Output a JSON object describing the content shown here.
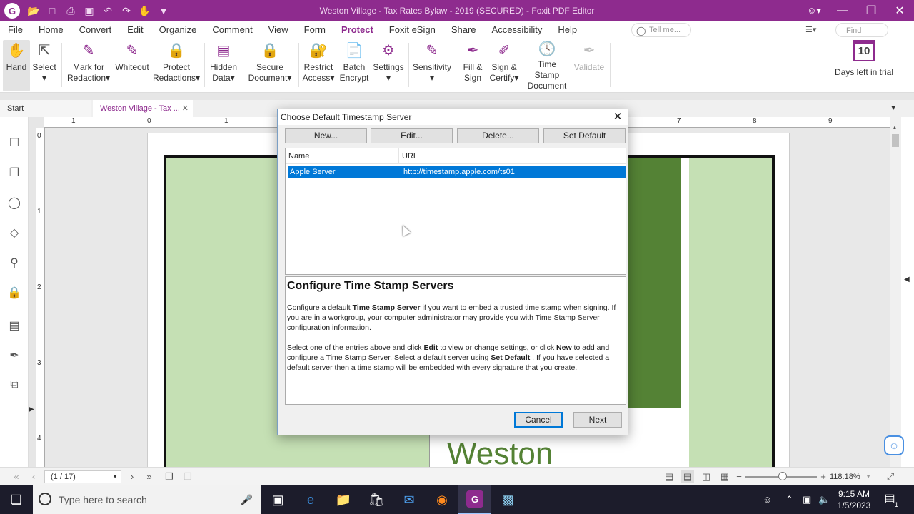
{
  "window": {
    "title": "Weston Village - Tax Rates Bylaw - 2019 (SECURED) - Foxit PDF Editor",
    "app_logo": "G"
  },
  "menu": {
    "tabs": [
      "File",
      "Home",
      "Convert",
      "Edit",
      "Organize",
      "Comment",
      "View",
      "Form",
      "Protect",
      "Foxit eSign",
      "Share",
      "Accessibility",
      "Help"
    ],
    "active_tab": "Protect",
    "tell_me_placeholder": "Tell me...",
    "find_placeholder": "Find"
  },
  "ribbon": {
    "hand": "Hand",
    "select": "Select",
    "mark_redaction_1": "Mark for",
    "mark_redaction_2": "Redaction",
    "whiteout": "Whiteout",
    "protect_redactions_1": "Protect",
    "protect_redactions_2": "Redactions",
    "hidden_data_1": "Hidden",
    "hidden_data_2": "Data",
    "secure_document_1": "Secure",
    "secure_document_2": "Document",
    "restrict_access_1": "Restrict",
    "restrict_access_2": "Access",
    "batch_encrypt_1": "Batch",
    "batch_encrypt_2": "Encrypt",
    "settings": "Settings",
    "sensitivity": "Sensitivity",
    "fill_sign_1": "Fill &",
    "fill_sign_2": "Sign",
    "sign_certify_1": "Sign &",
    "sign_certify_2": "Certify",
    "time_stamp_1": "Time Stamp",
    "time_stamp_2": "Document",
    "validate": "Validate",
    "trial_days": "10",
    "trial_label": "Days left in trial"
  },
  "doc_tabs": {
    "start": "Start",
    "document": "Weston Village - Tax ..."
  },
  "ruler": {
    "top": [
      "1",
      "0",
      "1",
      "7",
      "8",
      "9"
    ],
    "left": [
      "0",
      "1",
      "2",
      "3",
      "4"
    ]
  },
  "page": {
    "heading": "Weston"
  },
  "dialog": {
    "title": "Choose Default Timestamp Server",
    "buttons": {
      "new": "New...",
      "edit": "Edit...",
      "delete": "Delete...",
      "set_default": "Set Default"
    },
    "columns": {
      "name": "Name",
      "url": "URL"
    },
    "rows": [
      {
        "name": "Apple Server",
        "url": "http://timestamp.apple.com/ts01"
      }
    ],
    "info_heading": "Configure Time Stamp Servers",
    "p1_a": "Configure a default ",
    "p1_b": "Time Stamp Server",
    "p1_c": " if you want to embed a trusted time stamp when signing. If you are in a workgroup, your computer administrator may provide you with Time Stamp Server configuration information.",
    "p2_a": "Select one of the entries above and click ",
    "p2_b": "Edit",
    "p2_c": "  to view or change settings, or click ",
    "p2_d": "New",
    "p2_e": "  to add and configure a Time Stamp Server. Select a default server using ",
    "p2_f": "Set Default",
    "p2_g": " . If you have selected a default server then a time stamp will be embedded with every signature that you create.",
    "cancel": "Cancel",
    "next": "Next"
  },
  "statusbar": {
    "page_indicator": "(1 / 17)",
    "zoom": "118.18%"
  },
  "taskbar": {
    "search_placeholder": "Type here to search",
    "time": "9:15 AM",
    "date": "1/5/2023",
    "notification_count": "1"
  },
  "colors": {
    "brand": "#8e2b8e",
    "selection": "#0078d7",
    "page_green": "#c5e0b4",
    "dark_green": "#548235"
  }
}
